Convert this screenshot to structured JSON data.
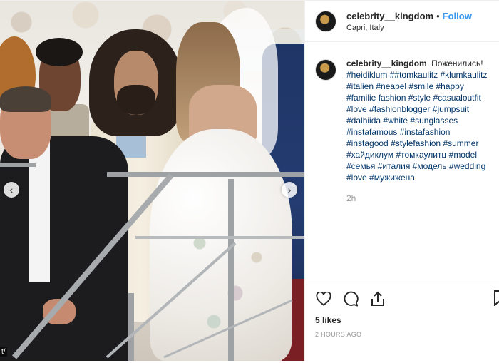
{
  "post": {
    "username": "celebrity__kingdom",
    "separator": "•",
    "follow_label": "Follow",
    "location": "Capri, Italy",
    "caption_text": "Поженились!",
    "hashtags": [
      "#heidiklum",
      "##tomkaulitz",
      "#klumkaulitz",
      "#italien",
      "#neapel",
      "#smile",
      "#happy",
      "#familie",
      "fashion",
      "#style",
      "#casualoutfit",
      "#love",
      "#fashionblogger",
      "#jumpsuit",
      "#dalhiida",
      "#white",
      "#sunglasses",
      "#instafamous",
      "#instafashion",
      "#instagood",
      "#stylefashion",
      "#summer",
      "#хайдиклум",
      "#томкаулитц",
      "#model",
      "#семья",
      "#италия",
      "#модель",
      "#wedding",
      "#love",
      "#мужижена"
    ],
    "caption_age": "2h",
    "likes": "5 likes",
    "posted": "2 HOURS AGO",
    "photo_overlay_text": "t/"
  },
  "icons": {
    "heart": "heart-icon",
    "comment": "comment-icon",
    "share": "share-icon",
    "bookmark": "bookmark-icon",
    "prev": "chevron-left-icon",
    "next": "chevron-right-icon"
  },
  "colors": {
    "link": "#3897f0",
    "hashtag": "#003569",
    "muted": "#999999"
  }
}
